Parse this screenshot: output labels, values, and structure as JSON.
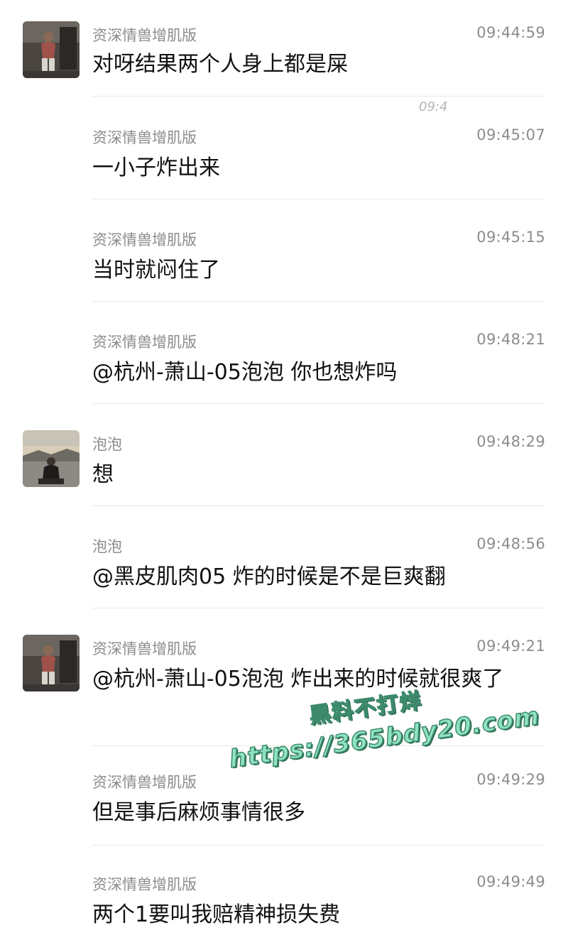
{
  "messages": [
    {
      "sender": "资深情兽增肌版",
      "time": "09:44:59",
      "text": "对呀结果两个人身上都是屎",
      "avatar": "gym-selfie"
    },
    {
      "sender": "资深情兽增肌版",
      "time": "09:45:07",
      "text": "一小子炸出来",
      "avatar": null
    },
    {
      "sender": "资深情兽增肌版",
      "time": "09:45:15",
      "text": "当时就闷住了",
      "avatar": null
    },
    {
      "sender": "资深情兽增肌版",
      "time": "09:48:21",
      "text": "@杭州-萧山-05泡泡 你也想炸吗",
      "avatar": null
    },
    {
      "sender": "泡泡",
      "time": "09:48:29",
      "text": "想",
      "avatar": "seaside-photo"
    },
    {
      "sender": "泡泡",
      "time": "09:48:56",
      "text": "@黑皮肌肉05 炸的时候是不是巨爽翻",
      "avatar": null
    },
    {
      "sender": "资深情兽增肌版",
      "time": "09:49:21",
      "text": "@杭州-萧山-05泡泡 炸出来的时候就很爽了",
      "avatar": "gym-selfie"
    },
    {
      "sender": "资深情兽增肌版",
      "time": "09:49:29",
      "text": "但是事后麻烦事情很多",
      "avatar": null
    },
    {
      "sender": "资深情兽增肌版",
      "time": "09:49:49",
      "text": "两个1要叫我赔精神损失费",
      "avatar": null
    }
  ],
  "artifact_text": "09:4",
  "watermark": {
    "line1": "黑料不打烊",
    "line2": "https://365bdy20.com"
  },
  "colors": {
    "meta_text": "#8c8c8c",
    "message_text": "#111111",
    "divider": "#e8e8e8",
    "watermark_fill": "#8fe3c2",
    "watermark_stroke": "#3d8a6c"
  }
}
